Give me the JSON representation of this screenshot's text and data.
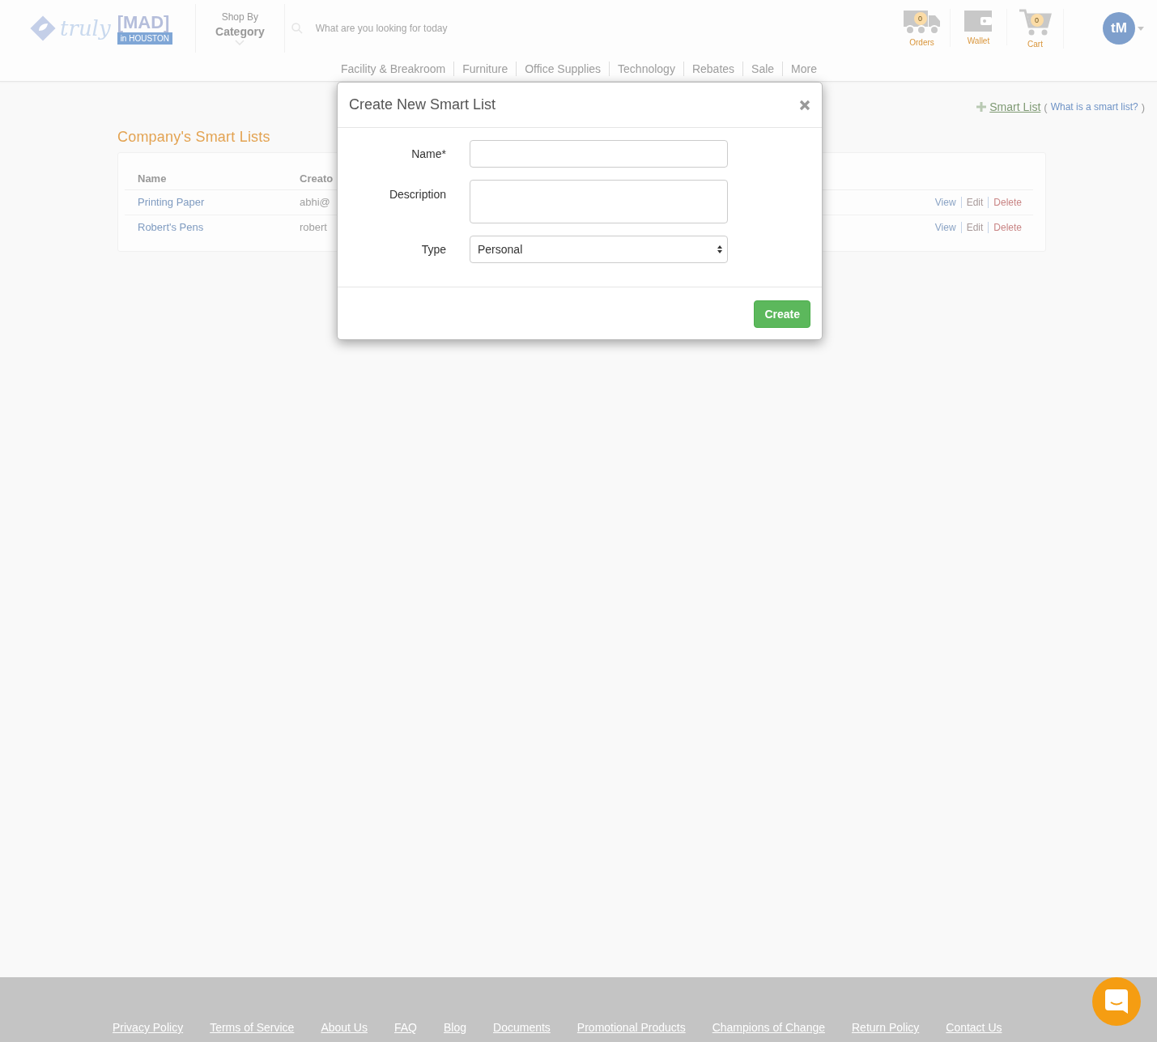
{
  "header": {
    "logo": {
      "script": "truly",
      "mark": "[MAD]",
      "tag": "in HOUSTON"
    },
    "shop_by": {
      "label": "Shop By",
      "title": "Category"
    },
    "search": {
      "placeholder": "What are you looking for today"
    },
    "icons": [
      {
        "kind": "truck",
        "label": "Orders",
        "badge": "0"
      },
      {
        "kind": "wallet",
        "label": "Wallet"
      },
      {
        "kind": "cart",
        "label": "Cart",
        "badge": "0"
      }
    ],
    "avatar": {
      "initials": "tM"
    }
  },
  "nav": [
    "Facility & Breakroom",
    "Furniture",
    "Office Supplies",
    "Technology",
    "Rebates",
    "Sale",
    "More"
  ],
  "smart_list_link": {
    "label": "Smart List",
    "open": "(",
    "help": "What is a smart list?",
    "close": ")"
  },
  "section_title": "Company's Smart Lists",
  "table": {
    "columns": [
      "Name",
      "Creato"
    ],
    "rows": [
      {
        "cells": [
          "Printing Paper",
          "abhi@"
        ],
        "actions": [
          "View",
          "Edit",
          "Delete"
        ]
      },
      {
        "cells": [
          "Robert's Pens",
          "robert"
        ],
        "actions": [
          "View",
          "Edit",
          "Delete"
        ]
      }
    ]
  },
  "modal": {
    "title": "Create New Smart List",
    "fields": [
      {
        "kind": "text",
        "label": "Name*"
      },
      {
        "kind": "textarea",
        "label": "Description"
      },
      {
        "kind": "select",
        "label": "Type",
        "value": "Personal"
      }
    ],
    "buttons": [
      {
        "label": "Create"
      }
    ]
  },
  "footer": {
    "links": [
      "Privacy Policy",
      "Terms of Service",
      "About Us",
      "FAQ",
      "Blog",
      "Documents",
      "Promotional Products",
      "Champions of Change",
      "Return Policy",
      "Contact Us"
    ]
  }
}
